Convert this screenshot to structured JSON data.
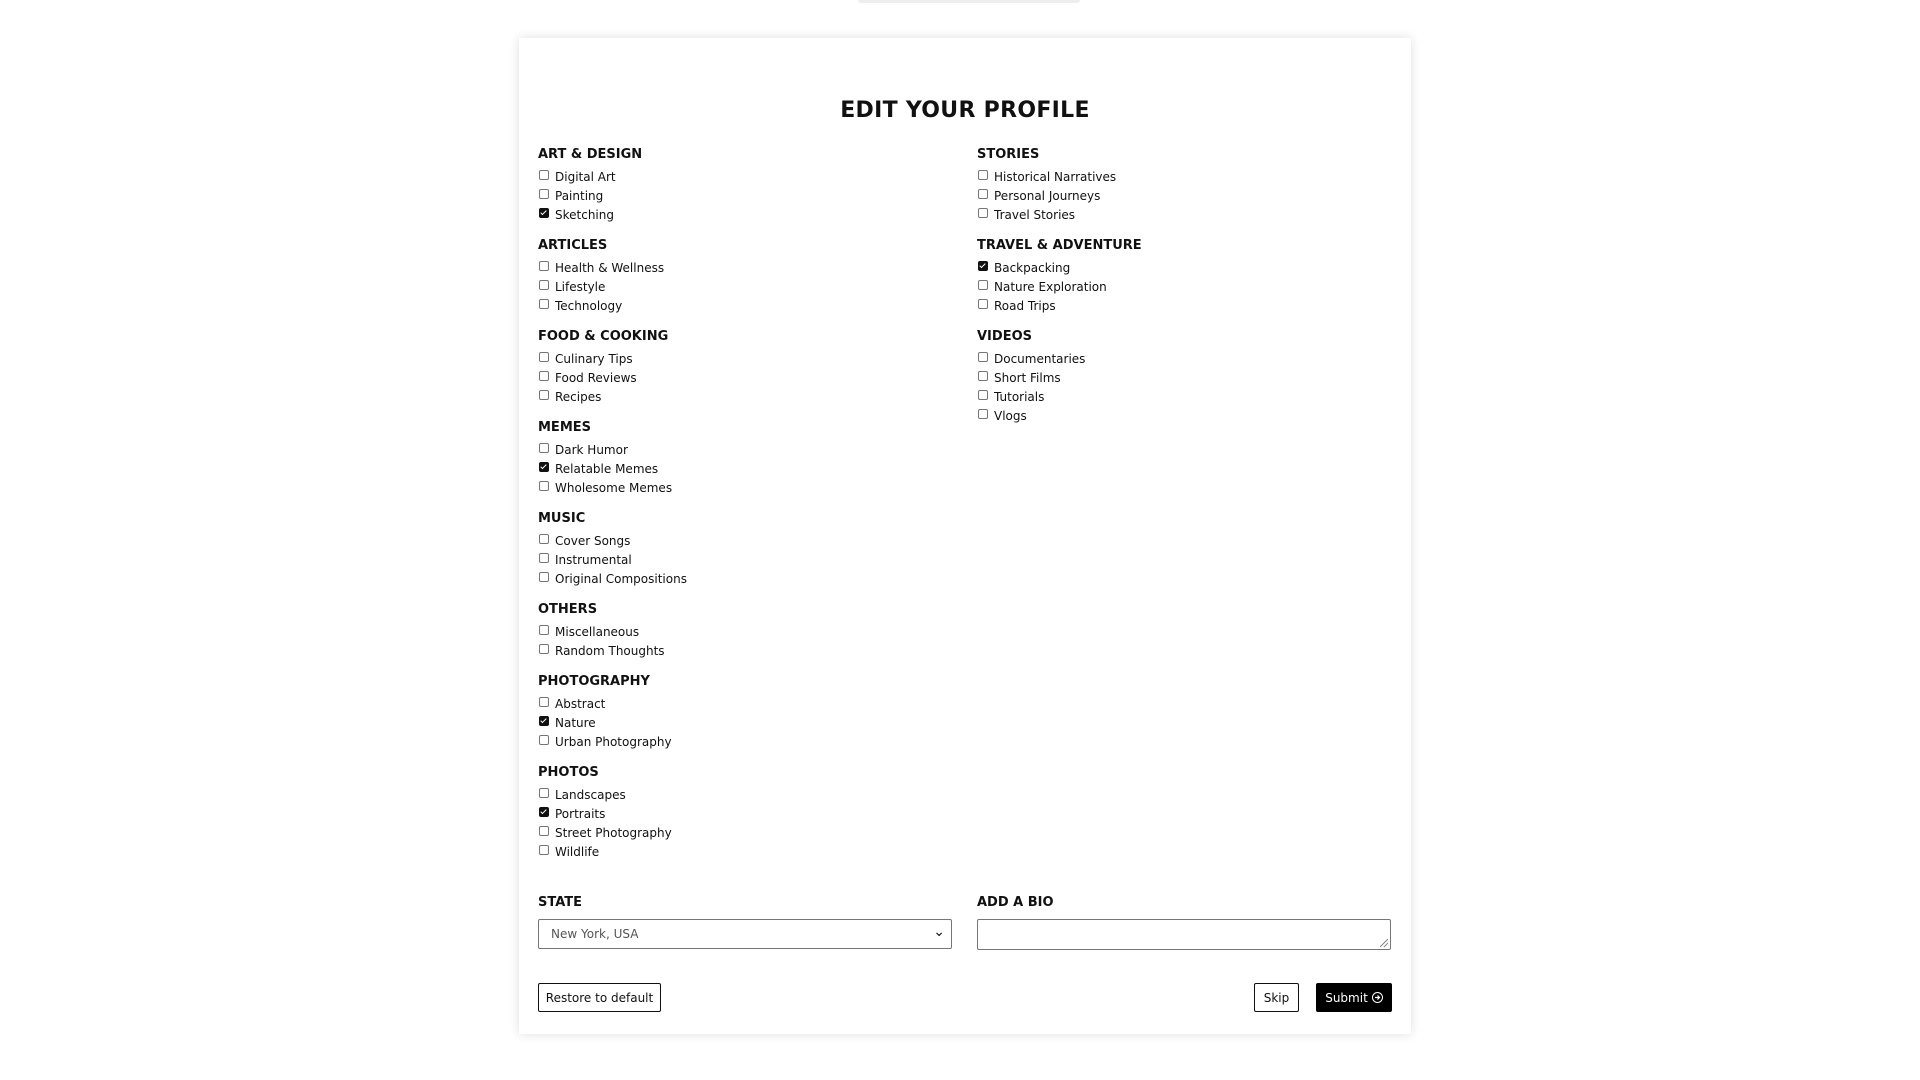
{
  "title": "EDIT YOUR PROFILE",
  "left_groups": [
    {
      "title": "ART & DESIGN",
      "options": [
        {
          "label": "Digital Art",
          "checked": false
        },
        {
          "label": "Painting",
          "checked": false
        },
        {
          "label": "Sketching",
          "checked": true
        }
      ]
    },
    {
      "title": "ARTICLES",
      "options": [
        {
          "label": "Health & Wellness",
          "checked": false
        },
        {
          "label": "Lifestyle",
          "checked": false
        },
        {
          "label": "Technology",
          "checked": false
        }
      ]
    },
    {
      "title": "FOOD & COOKING",
      "options": [
        {
          "label": "Culinary Tips",
          "checked": false
        },
        {
          "label": "Food Reviews",
          "checked": false
        },
        {
          "label": "Recipes",
          "checked": false
        }
      ]
    },
    {
      "title": "MEMES",
      "options": [
        {
          "label": "Dark Humor",
          "checked": false
        },
        {
          "label": "Relatable Memes",
          "checked": true
        },
        {
          "label": "Wholesome Memes",
          "checked": false
        }
      ]
    },
    {
      "title": "MUSIC",
      "options": [
        {
          "label": "Cover Songs",
          "checked": false
        },
        {
          "label": "Instrumental",
          "checked": false
        },
        {
          "label": "Original Compositions",
          "checked": false
        }
      ]
    },
    {
      "title": "OTHERS",
      "options": [
        {
          "label": "Miscellaneous",
          "checked": false
        },
        {
          "label": "Random Thoughts",
          "checked": false
        }
      ]
    },
    {
      "title": "PHOTOGRAPHY",
      "options": [
        {
          "label": "Abstract",
          "checked": false
        },
        {
          "label": "Nature",
          "checked": true
        },
        {
          "label": "Urban Photography",
          "checked": false
        }
      ]
    },
    {
      "title": "PHOTOS",
      "options": [
        {
          "label": "Landscapes",
          "checked": false
        },
        {
          "label": "Portraits",
          "checked": true
        },
        {
          "label": "Street Photography",
          "checked": false
        },
        {
          "label": "Wildlife",
          "checked": false
        }
      ]
    }
  ],
  "right_groups": [
    {
      "title": "STORIES",
      "options": [
        {
          "label": "Historical Narratives",
          "checked": false
        },
        {
          "label": "Personal Journeys",
          "checked": false
        },
        {
          "label": "Travel Stories",
          "checked": false
        }
      ]
    },
    {
      "title": "TRAVEL & ADVENTURE",
      "options": [
        {
          "label": "Backpacking",
          "checked": true
        },
        {
          "label": "Nature Exploration",
          "checked": false
        },
        {
          "label": "Road Trips",
          "checked": false
        }
      ]
    },
    {
      "title": "VIDEOS",
      "options": [
        {
          "label": "Documentaries",
          "checked": false
        },
        {
          "label": "Short Films",
          "checked": false
        },
        {
          "label": "Tutorials",
          "checked": false
        },
        {
          "label": "Vlogs",
          "checked": false
        }
      ]
    }
  ],
  "state": {
    "label": "STATE",
    "value": "New York, USA"
  },
  "bio": {
    "label": "ADD A BIO",
    "value": ""
  },
  "buttons": {
    "restore": "Restore to default",
    "skip": "Skip",
    "submit": "Submit"
  },
  "colors": {
    "accent": "#000000",
    "card_bg": "#ffffff",
    "border": "#767676"
  }
}
